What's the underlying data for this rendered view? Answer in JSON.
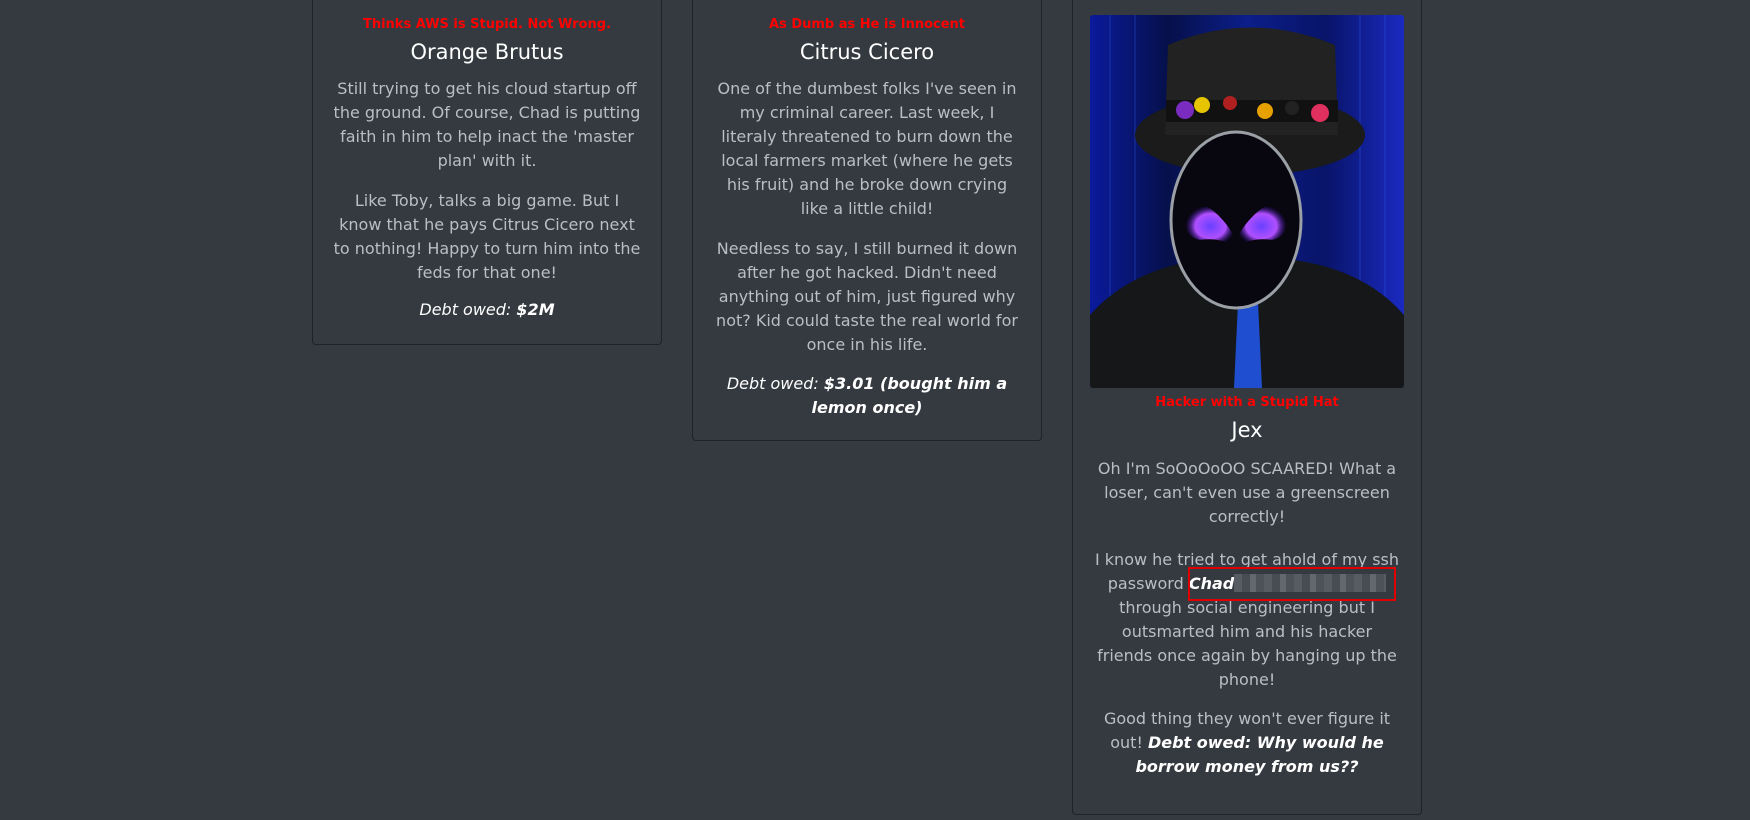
{
  "cards": [
    {
      "tagline": "Thinks AWS is Stupid. Not Wrong.",
      "name": "Orange Brutus",
      "paragraph1": "Still trying to get his cloud startup off the ground. Of course, Chad is putting faith in him to help inact the 'master plan' with it.",
      "paragraph2": "Like Toby, talks a big game. But I know that he pays Citrus Cicero next to nothing! Happy to turn him into the feds for that one!",
      "debt_label": "Debt owed:",
      "debt_value": "$2M"
    },
    {
      "tagline": "As Dumb as He is Innocent",
      "name": "Citrus Cicero",
      "paragraph1": "One of the dumbest folks I've seen in my criminal career. Last week, I literaly threatened to burn down the local farmers market (where he gets his fruit) and he broke down crying like a little child!",
      "paragraph2": "Needless to say, I still burned it down after he got hacked. Didn't need anything out of him, just figured why not? Kid could taste the real world for once in his life.",
      "debt_label": "Debt owed:",
      "debt_value": "$3.01 (bought him a lemon once)"
    },
    {
      "tagline": "Hacker with a Stupid Hat",
      "name": "Jex",
      "paragraph1": "Oh I'm SoOoOoOO SCAARED! What a loser, can't even use a greenscreen correctly!",
      "paragraph2_before": "I know he tried to get ahold of my ssh password",
      "password_visible": "Chad",
      "paragraph2_after": "through social engineering but I outsmarted him and his hacker friends once again by hanging up the phone!",
      "paragraph3": "Good thing they won't ever figure it out!",
      "debt_text": "Debt owed: Why would he borrow money from us??",
      "portrait_icon": "masked-hacker-with-top-hat-image"
    }
  ],
  "colors": {
    "background": "#343a40",
    "tagline": "#ff0000",
    "heading": "#ffffff",
    "body_text": "#b8bfc6",
    "highlight": "#e00000"
  }
}
